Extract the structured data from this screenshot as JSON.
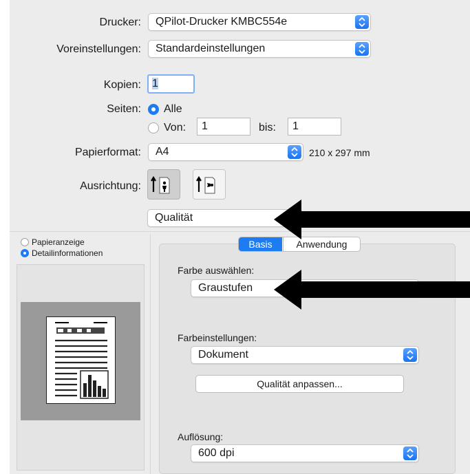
{
  "printer": {
    "label": "Drucker:",
    "value": "QPilot-Drucker KMBC554e"
  },
  "presets": {
    "label": "Voreinstellungen:",
    "value": "Standardeinstellungen"
  },
  "copies": {
    "label": "Kopien:",
    "value": "1"
  },
  "pages": {
    "label": "Seiten:",
    "all_label": "Alle",
    "from_label": "Von:",
    "from_value": "1",
    "to_label": "bis:",
    "to_value": "1",
    "selected": "Alle"
  },
  "paper": {
    "label": "Papierformat:",
    "value": "A4",
    "size_text": "210 x 297 mm"
  },
  "orientation": {
    "label": "Ausrichtung:",
    "selected": "portrait"
  },
  "section_popup": {
    "value": "Qualität"
  },
  "preview_options": {
    "option1": "Papieranzeige",
    "option2": "Detailinformationen",
    "selected": "Detailinformationen"
  },
  "tabs": {
    "basis": "Basis",
    "anwendung": "Anwendung",
    "active": "Basis"
  },
  "color_select": {
    "label": "Farbe auswählen:",
    "value": "Graustufen"
  },
  "color_settings": {
    "label": "Farbeinstellungen:",
    "value": "Dokument"
  },
  "quality_button": {
    "label": "Qualität anpassen..."
  },
  "resolution": {
    "label": "Auflösung:",
    "value": "600 dpi"
  },
  "colors": {
    "accent": "#1d7cf2",
    "annotation_arrow": "#000000"
  }
}
